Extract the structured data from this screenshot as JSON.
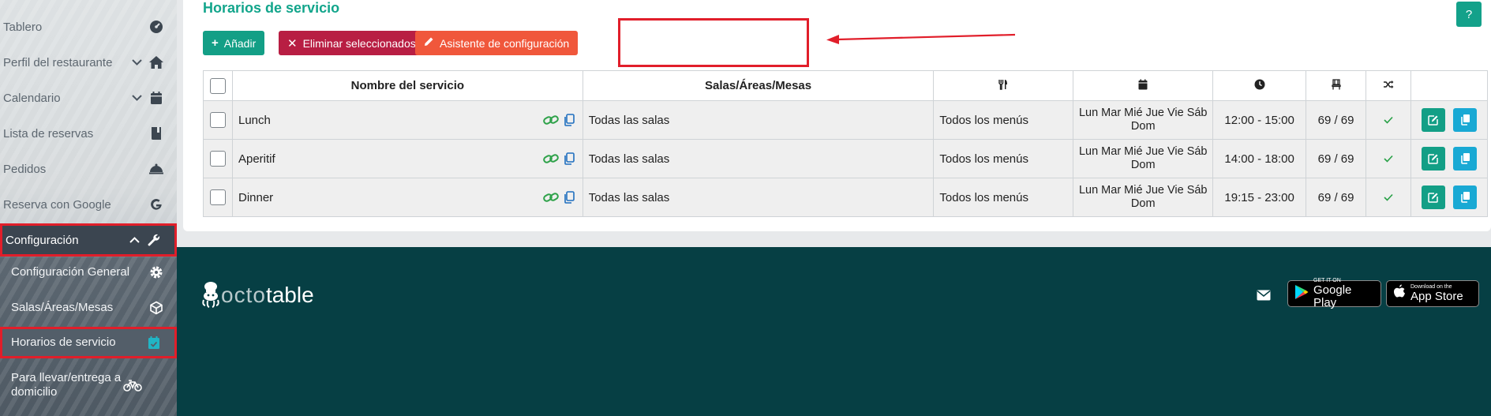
{
  "sidebar": {
    "items": [
      {
        "label": "Tablero",
        "icon": "dashboard-icon"
      },
      {
        "label": "Perfil del restaurante",
        "icon": "home-icon"
      },
      {
        "label": "Calendario",
        "icon": "calendar-icon"
      },
      {
        "label": "Lista de reservas",
        "icon": "book-icon"
      },
      {
        "label": "Pedidos",
        "icon": "bell-icon"
      },
      {
        "label": "Reserva con Google",
        "icon": "google-icon"
      },
      {
        "label": "Configuración",
        "icon": "wrench-icon"
      }
    ],
    "sub_items": [
      {
        "label": "Configuración General",
        "icon": "gear-icon"
      },
      {
        "label": "Salas/Áreas/Mesas",
        "icon": "cube-icon"
      },
      {
        "label": "Horarios de servicio",
        "icon": "calendar-check-icon"
      },
      {
        "label": "Para llevar/entrega a domicilio",
        "icon": "bicycle-icon"
      }
    ]
  },
  "header": {
    "title": "Horarios de servicio",
    "help_label": "?"
  },
  "toolbar": {
    "add_label": "Añadir",
    "delete_label": "Eliminar seleccionados",
    "wizard_label": "Asistente de configuración"
  },
  "table": {
    "headers": {
      "name": "Nombre del servicio",
      "rooms": "Salas/Áreas/Mesas"
    },
    "rows": [
      {
        "name": "Lunch",
        "rooms": "Todas las salas",
        "menus": "Todos los menús",
        "days": "Lun Mar Mié Jue Vie Sáb Dom",
        "hours": "12:00 - 15:00",
        "capacity": "69 / 69"
      },
      {
        "name": "Aperitif",
        "rooms": "Todas las salas",
        "menus": "Todos los menús",
        "days": "Lun Mar Mié Jue Vie Sáb Dom",
        "hours": "14:00 - 18:00",
        "capacity": "69 / 69"
      },
      {
        "name": "Dinner",
        "rooms": "Todas las salas",
        "menus": "Todos los menús",
        "days": "Lun Mar Mié Jue Vie Sáb Dom",
        "hours": "19:15 - 23:00",
        "capacity": "69 / 69"
      }
    ]
  },
  "footer": {
    "logo_part1": "octo",
    "logo_part2": "table",
    "google_play_small": "GET IT ON",
    "google_play_big": "Google Play",
    "app_store_small": "Download on the",
    "app_store_big": "App Store"
  },
  "colors": {
    "accent": "#139f86",
    "danger": "#b81e43",
    "wizard": "#f0573b",
    "footer_bg": "#063f44",
    "highlight": "#e11e2a"
  }
}
